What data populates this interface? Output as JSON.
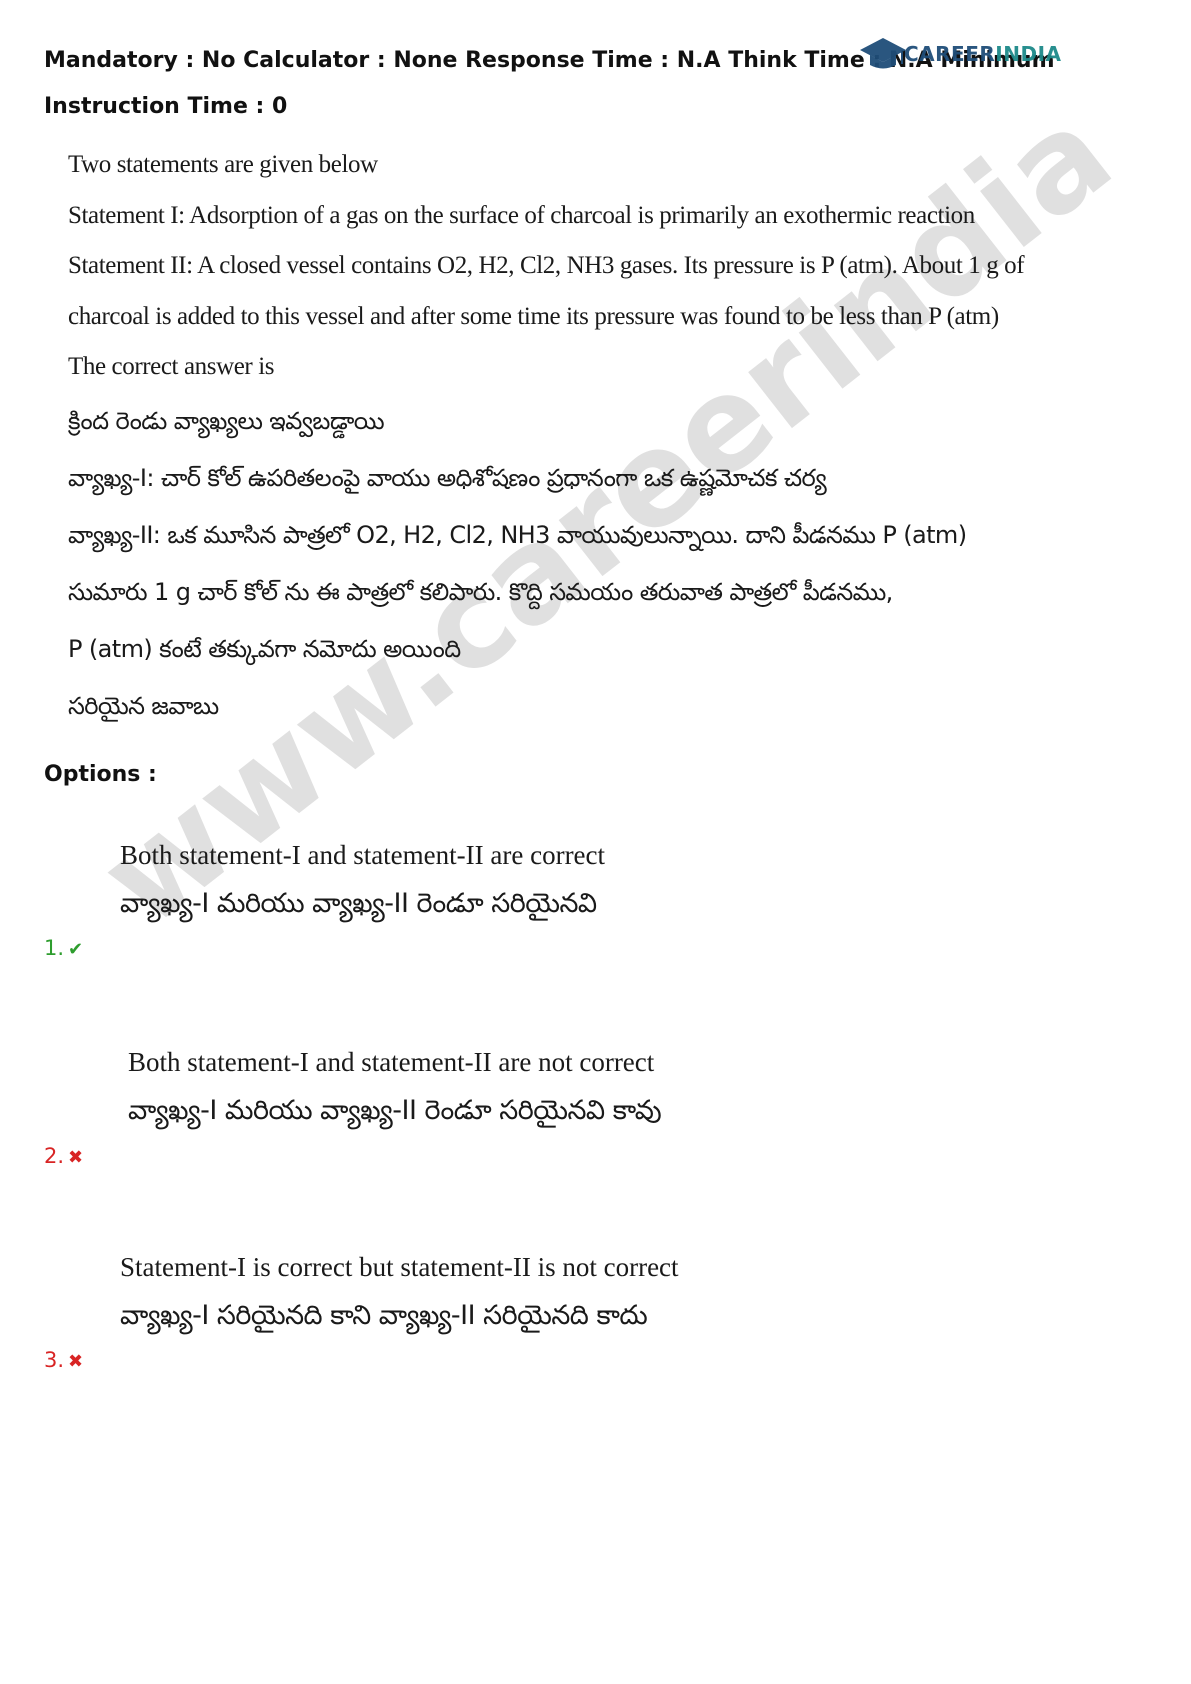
{
  "header": {
    "text": "Mandatory : No Calculator : None Response Time : N.A Think Time : N.A Minimum Instruction Time : 0"
  },
  "logo": {
    "text_career": "CAREER",
    "text_india": "INDIA",
    "icon": "graduation-cap-icon"
  },
  "watermark": {
    "text": "www.careerindia"
  },
  "question": {
    "lines": [
      "Two statements are given below",
      "Statement I: Adsorption of a gas on the surface of charcoal is primarily an exothermic reaction",
      "Statement II: A closed vessel contains O2, H2, Cl2, NH3 gases. Its pressure is P (atm). About 1 g of",
      "charcoal is added to this vessel and after some time its pressure was found to be less than P (atm)",
      "The correct answer is",
      "క్రింద రెండు వ్యాఖ్యలు ఇవ్వబడ్డాయి",
      "వ్యాఖ్య-I: చార్ కోల్ ఉపరితలంపై వాయు అధిశోషణం ప్రధానంగా ఒక ఉష్ణమోచక చర్య",
      "వ్యాఖ్య-II: ఒక మూసిన పాత్రలో O2, H2, Cl2, NH3 వాయువులున్నాయి. దాని పీడనము P (atm)",
      "సుమారు 1 g చార్ కోల్ ను ఈ పాత్రలో కలిపారు. కొద్ది సమయం తరువాత పాత్రలో పీడనము,",
      "P (atm) కంటే తక్కువగా నమోదు అయింది",
      "సరియైన జవాబు"
    ]
  },
  "options_label": "Options :",
  "options": [
    {
      "number": "1.",
      "mark": "✔",
      "status": "correct",
      "en": "Both statement-I and statement-II are correct",
      "te": "వ్యాఖ్య-I మరియు వ్యాఖ్య-II రెండూ సరియైనవి"
    },
    {
      "number": "2.",
      "mark": "✖",
      "status": "wrong",
      "en": "Both statement-I and statement-II are not correct",
      "te": "వ్యాఖ్య-I మరియు వ్యాఖ్య-II రెండూ సరియైనవి కావు"
    },
    {
      "number": "3.",
      "mark": "✖",
      "status": "wrong",
      "en": "Statement-I is correct but statement-II is not correct",
      "te": "వ్యాఖ్య-I సరియైనది కాని వ్యాఖ్య-II సరియైనది కాదు"
    }
  ],
  "colors": {
    "correct": "#2e9d2e",
    "wrong": "#d82424",
    "logo_blue": "#1f4e79",
    "logo_teal": "#1d8a8a"
  }
}
